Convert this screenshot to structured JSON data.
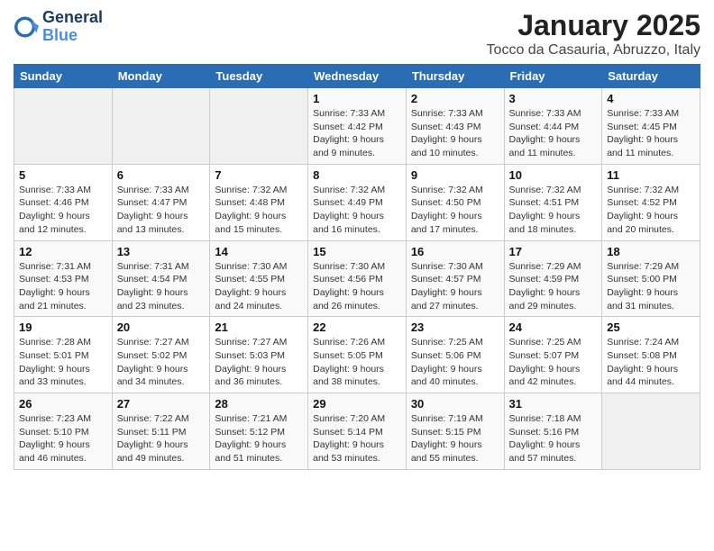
{
  "header": {
    "logo_line1": "General",
    "logo_line2": "Blue",
    "month": "January 2025",
    "location": "Tocco da Casauria, Abruzzo, Italy"
  },
  "weekdays": [
    "Sunday",
    "Monday",
    "Tuesday",
    "Wednesday",
    "Thursday",
    "Friday",
    "Saturday"
  ],
  "weeks": [
    [
      {
        "day": "",
        "info": ""
      },
      {
        "day": "",
        "info": ""
      },
      {
        "day": "",
        "info": ""
      },
      {
        "day": "1",
        "info": "Sunrise: 7:33 AM\nSunset: 4:42 PM\nDaylight: 9 hours and 9 minutes."
      },
      {
        "day": "2",
        "info": "Sunrise: 7:33 AM\nSunset: 4:43 PM\nDaylight: 9 hours and 10 minutes."
      },
      {
        "day": "3",
        "info": "Sunrise: 7:33 AM\nSunset: 4:44 PM\nDaylight: 9 hours and 11 minutes."
      },
      {
        "day": "4",
        "info": "Sunrise: 7:33 AM\nSunset: 4:45 PM\nDaylight: 9 hours and 11 minutes."
      }
    ],
    [
      {
        "day": "5",
        "info": "Sunrise: 7:33 AM\nSunset: 4:46 PM\nDaylight: 9 hours and 12 minutes."
      },
      {
        "day": "6",
        "info": "Sunrise: 7:33 AM\nSunset: 4:47 PM\nDaylight: 9 hours and 13 minutes."
      },
      {
        "day": "7",
        "info": "Sunrise: 7:32 AM\nSunset: 4:48 PM\nDaylight: 9 hours and 15 minutes."
      },
      {
        "day": "8",
        "info": "Sunrise: 7:32 AM\nSunset: 4:49 PM\nDaylight: 9 hours and 16 minutes."
      },
      {
        "day": "9",
        "info": "Sunrise: 7:32 AM\nSunset: 4:50 PM\nDaylight: 9 hours and 17 minutes."
      },
      {
        "day": "10",
        "info": "Sunrise: 7:32 AM\nSunset: 4:51 PM\nDaylight: 9 hours and 18 minutes."
      },
      {
        "day": "11",
        "info": "Sunrise: 7:32 AM\nSunset: 4:52 PM\nDaylight: 9 hours and 20 minutes."
      }
    ],
    [
      {
        "day": "12",
        "info": "Sunrise: 7:31 AM\nSunset: 4:53 PM\nDaylight: 9 hours and 21 minutes."
      },
      {
        "day": "13",
        "info": "Sunrise: 7:31 AM\nSunset: 4:54 PM\nDaylight: 9 hours and 23 minutes."
      },
      {
        "day": "14",
        "info": "Sunrise: 7:30 AM\nSunset: 4:55 PM\nDaylight: 9 hours and 24 minutes."
      },
      {
        "day": "15",
        "info": "Sunrise: 7:30 AM\nSunset: 4:56 PM\nDaylight: 9 hours and 26 minutes."
      },
      {
        "day": "16",
        "info": "Sunrise: 7:30 AM\nSunset: 4:57 PM\nDaylight: 9 hours and 27 minutes."
      },
      {
        "day": "17",
        "info": "Sunrise: 7:29 AM\nSunset: 4:59 PM\nDaylight: 9 hours and 29 minutes."
      },
      {
        "day": "18",
        "info": "Sunrise: 7:29 AM\nSunset: 5:00 PM\nDaylight: 9 hours and 31 minutes."
      }
    ],
    [
      {
        "day": "19",
        "info": "Sunrise: 7:28 AM\nSunset: 5:01 PM\nDaylight: 9 hours and 33 minutes."
      },
      {
        "day": "20",
        "info": "Sunrise: 7:27 AM\nSunset: 5:02 PM\nDaylight: 9 hours and 34 minutes."
      },
      {
        "day": "21",
        "info": "Sunrise: 7:27 AM\nSunset: 5:03 PM\nDaylight: 9 hours and 36 minutes."
      },
      {
        "day": "22",
        "info": "Sunrise: 7:26 AM\nSunset: 5:05 PM\nDaylight: 9 hours and 38 minutes."
      },
      {
        "day": "23",
        "info": "Sunrise: 7:25 AM\nSunset: 5:06 PM\nDaylight: 9 hours and 40 minutes."
      },
      {
        "day": "24",
        "info": "Sunrise: 7:25 AM\nSunset: 5:07 PM\nDaylight: 9 hours and 42 minutes."
      },
      {
        "day": "25",
        "info": "Sunrise: 7:24 AM\nSunset: 5:08 PM\nDaylight: 9 hours and 44 minutes."
      }
    ],
    [
      {
        "day": "26",
        "info": "Sunrise: 7:23 AM\nSunset: 5:10 PM\nDaylight: 9 hours and 46 minutes."
      },
      {
        "day": "27",
        "info": "Sunrise: 7:22 AM\nSunset: 5:11 PM\nDaylight: 9 hours and 49 minutes."
      },
      {
        "day": "28",
        "info": "Sunrise: 7:21 AM\nSunset: 5:12 PM\nDaylight: 9 hours and 51 minutes."
      },
      {
        "day": "29",
        "info": "Sunrise: 7:20 AM\nSunset: 5:14 PM\nDaylight: 9 hours and 53 minutes."
      },
      {
        "day": "30",
        "info": "Sunrise: 7:19 AM\nSunset: 5:15 PM\nDaylight: 9 hours and 55 minutes."
      },
      {
        "day": "31",
        "info": "Sunrise: 7:18 AM\nSunset: 5:16 PM\nDaylight: 9 hours and 57 minutes."
      },
      {
        "day": "",
        "info": ""
      }
    ]
  ]
}
